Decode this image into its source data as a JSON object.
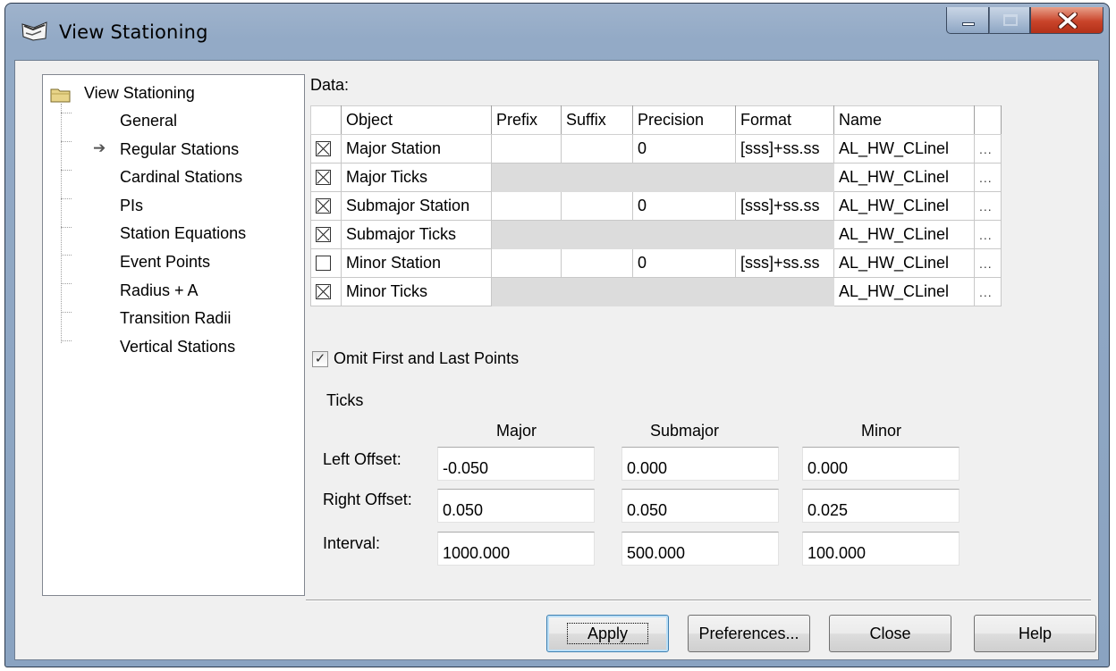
{
  "window": {
    "title": "View Stationing"
  },
  "tree": {
    "root": "View Stationing",
    "items": [
      "General",
      "Regular Stations",
      "Cardinal Stations",
      "PIs",
      "Station Equations",
      "Event Points",
      "Radius + A",
      "Transition Radii",
      "Vertical Stations"
    ],
    "selected_marker": "➔"
  },
  "data": {
    "label": "Data:",
    "columns": [
      "Object",
      "Prefix",
      "Suffix",
      "Precision",
      "Format",
      "Name"
    ],
    "rows": [
      {
        "checked": true,
        "object": "Major Station",
        "prefix": "",
        "suffix": "",
        "precision": "0",
        "format": "[sss]+ss.ss",
        "name": "AL_HW_CLinel",
        "more": "..."
      },
      {
        "checked": true,
        "object": "Major Ticks",
        "name": "AL_HW_CLinel",
        "more": "..."
      },
      {
        "checked": true,
        "object": "Submajor Station",
        "prefix": "",
        "suffix": "",
        "precision": "0",
        "format": "[sss]+ss.ss",
        "name": "AL_HW_CLinel",
        "more": "..."
      },
      {
        "checked": true,
        "object": "Submajor Ticks",
        "name": "AL_HW_CLinel",
        "more": "..."
      },
      {
        "checked": false,
        "object": "Minor Station",
        "prefix": "",
        "suffix": "",
        "precision": "0",
        "format": "[sss]+ss.ss",
        "name": "AL_HW_CLinel",
        "more": "..."
      },
      {
        "checked": true,
        "object": "Minor Ticks",
        "name": "AL_HW_CLinel",
        "more": "..."
      }
    ]
  },
  "omit": {
    "label": "Omit First and Last Points",
    "checked": true,
    "mark": "✓"
  },
  "ticks": {
    "label": "Ticks",
    "columns": [
      "Major",
      "Submajor",
      "Minor"
    ],
    "left_offset": {
      "label": "Left Offset:",
      "values": [
        "-0.050",
        "0.000",
        "0.000"
      ]
    },
    "right_offset": {
      "label": "Right Offset:",
      "values": [
        "0.050",
        "0.050",
        "0.025"
      ]
    },
    "interval": {
      "label": "Interval:",
      "values": [
        "1000.000",
        "500.000",
        "100.000"
      ]
    }
  },
  "buttons": {
    "apply": "Apply",
    "preferences": "Preferences...",
    "close": "Close",
    "help": "Help"
  },
  "colors": {
    "caption": "#93aac6",
    "close": "#c9442a",
    "grey_cell": "#dcdcdc"
  }
}
